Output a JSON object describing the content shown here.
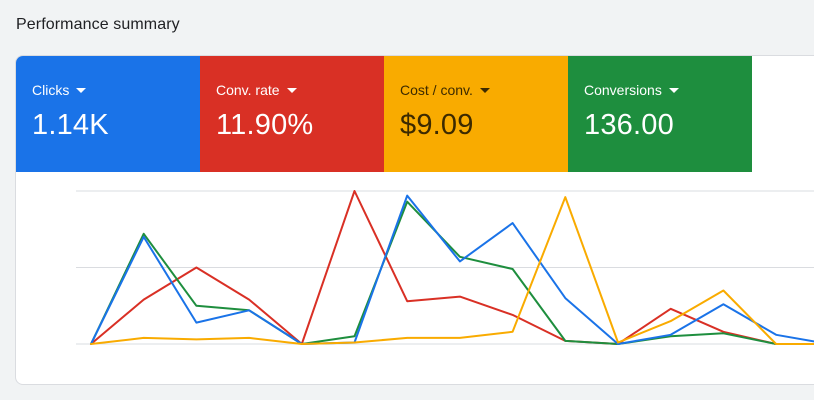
{
  "page": {
    "title": "Performance summary"
  },
  "metrics": [
    {
      "label": "Clicks",
      "value": "1.14K",
      "color": "#1a73e8"
    },
    {
      "label": "Conv. rate",
      "value": "11.90%",
      "color": "#d93025"
    },
    {
      "label": "Cost / conv.",
      "value": "$9.09",
      "color": "#f9ab00"
    },
    {
      "label": "Conversions",
      "value": "136.00",
      "color": "#1e8e3e"
    }
  ],
  "chart_data": {
    "type": "line",
    "x": [
      0,
      1,
      2,
      3,
      4,
      5,
      6,
      7,
      8,
      9,
      10,
      11,
      12,
      13,
      14,
      15
    ],
    "ylim": [
      0,
      100
    ],
    "grid": true,
    "series": [
      {
        "color": "#d93025",
        "values": [
          0,
          29,
          50,
          29,
          0,
          100,
          28,
          31,
          19,
          2,
          0,
          23,
          8,
          0,
          0,
          0
        ]
      },
      {
        "color": "#1e8e3e",
        "values": [
          0,
          72,
          25,
          22,
          0,
          5,
          93,
          57,
          49,
          2,
          0,
          5,
          7,
          0,
          0,
          0
        ]
      },
      {
        "color": "#1a73e8",
        "values": [
          0,
          70,
          14,
          22,
          0,
          1,
          97,
          54,
          79,
          30,
          0,
          6,
          26,
          6,
          0,
          0
        ]
      },
      {
        "color": "#f9ab00",
        "values": [
          0,
          4,
          3,
          4,
          0,
          1,
          4,
          4,
          8,
          96,
          1,
          15,
          35,
          0,
          0,
          0
        ]
      }
    ]
  }
}
